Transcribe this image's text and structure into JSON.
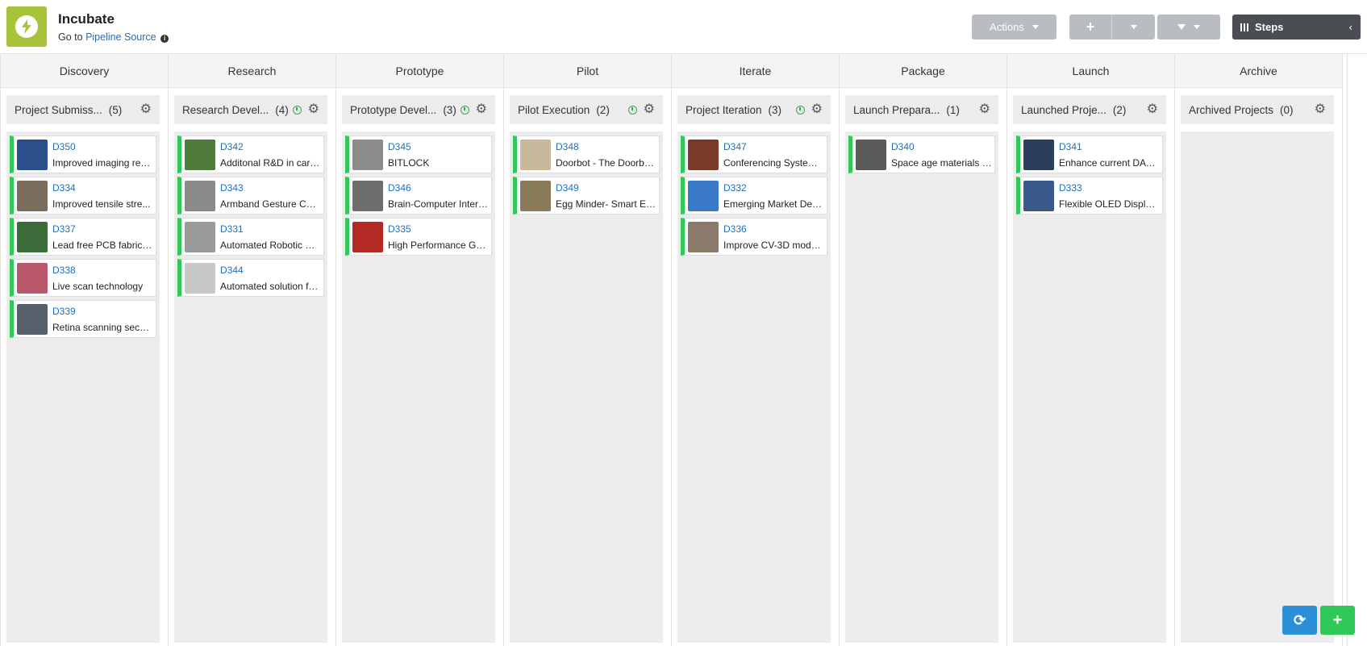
{
  "header": {
    "app_title": "Incubate",
    "goto_prefix": "Go to",
    "goto_link": "Pipeline Source",
    "actions_label": "Actions",
    "steps_label": "Steps",
    "add_symbol": "+",
    "steps_collapse": "‹"
  },
  "colors": {
    "logo": "#a7c33a",
    "card_accent": "#2fc95a",
    "link": "#1f6fb8",
    "steps_btn": "#4a4d51",
    "refresh": "#2c8fd8",
    "add": "#2fc95a"
  },
  "stages": [
    {
      "title": "Discovery",
      "column": {
        "name": "Project Submiss...",
        "count": "(5)",
        "clock": false,
        "cards": [
          {
            "id": "D350",
            "title": "Improved imaging res...",
            "thumb": "#2a4f8a"
          },
          {
            "id": "D334",
            "title": "Improved tensile stre...",
            "thumb": "#7a6d5c"
          },
          {
            "id": "D337",
            "title": "Lead free PCB fabricat...",
            "thumb": "#3c6b3a"
          },
          {
            "id": "D338",
            "title": "Live scan technology",
            "thumb": "#b9586a"
          },
          {
            "id": "D339",
            "title": "Retina scanning security",
            "thumb": "#55606a"
          }
        ]
      }
    },
    {
      "title": "Research",
      "column": {
        "name": "Research Devel...",
        "count": "(4)",
        "clock": true,
        "cards": [
          {
            "id": "D342",
            "title": "Additonal R&D in carb...",
            "thumb": "#4e7c3c"
          },
          {
            "id": "D343",
            "title": "Armband Gesture Con...",
            "thumb": "#8a8a8a"
          },
          {
            "id": "D331",
            "title": "Automated Robotic W...",
            "thumb": "#9a9a9a"
          },
          {
            "id": "D344",
            "title": "Automated solution fo...",
            "thumb": "#c8c8c8"
          }
        ]
      }
    },
    {
      "title": "Prototype",
      "column": {
        "name": "Prototype Devel...",
        "count": "(3)",
        "clock": true,
        "cards": [
          {
            "id": "D345",
            "title": "BITLOCK",
            "thumb": "#8c8c8c"
          },
          {
            "id": "D346",
            "title": "Brain-Computer Interf...",
            "thumb": "#6e6e6e"
          },
          {
            "id": "D335",
            "title": "High Performance GP...",
            "thumb": "#b32a24"
          }
        ]
      }
    },
    {
      "title": "Pilot",
      "column": {
        "name": "Pilot Execution",
        "count": "(2)",
        "clock": true,
        "cards": [
          {
            "id": "D348",
            "title": "Doorbot - The Doorbe...",
            "thumb": "#c9b89a"
          },
          {
            "id": "D349",
            "title": "Egg Minder- Smart Eg...",
            "thumb": "#8a7a5a"
          }
        ]
      }
    },
    {
      "title": "Iterate",
      "column": {
        "name": "Project Iteration",
        "count": "(3)",
        "clock": true,
        "cards": [
          {
            "id": "D347",
            "title": "Conferencing System ...",
            "thumb": "#7a3a2a"
          },
          {
            "id": "D332",
            "title": "Emerging Market Dev...",
            "thumb": "#3a7ac8"
          },
          {
            "id": "D336",
            "title": "Improve CV-3D modeli...",
            "thumb": "#8a7a6a"
          }
        ]
      }
    },
    {
      "title": "Package",
      "column": {
        "name": "Launch Prepara...",
        "count": "(1)",
        "clock": false,
        "cards": [
          {
            "id": "D340",
            "title": "Space age materials f...",
            "thumb": "#5a5a5a"
          }
        ]
      }
    },
    {
      "title": "Launch",
      "column": {
        "name": "Launched Proje...",
        "count": "(2)",
        "clock": false,
        "cards": [
          {
            "id": "D341",
            "title": "Enhance current DAW...",
            "thumb": "#2a3e5a"
          },
          {
            "id": "D333",
            "title": "Flexible OLED Displays",
            "thumb": "#3a5a8a"
          }
        ]
      }
    },
    {
      "title": "Archive",
      "column": {
        "name": "Archived Projects",
        "count": "(0)",
        "clock": false,
        "cards": []
      }
    }
  ]
}
